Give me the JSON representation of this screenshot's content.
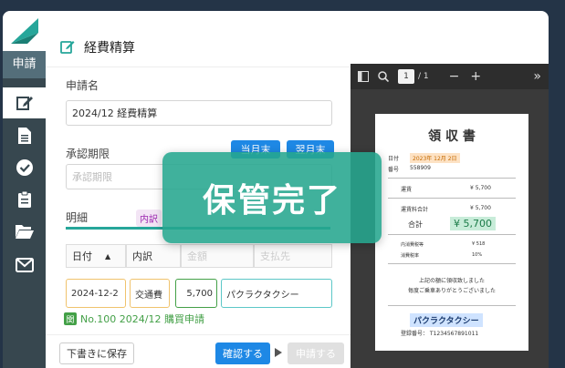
{
  "sidebar": {
    "active_label": "申請",
    "icons": [
      "edit-icon",
      "document-icon",
      "check-circle-icon",
      "clipboard-icon",
      "folder-open-icon",
      "mail-icon"
    ]
  },
  "header": {
    "title": "経費精算"
  },
  "form": {
    "application_name_label": "申請名",
    "application_name_value": "2024/12 経費精算",
    "deadline_label": "承認期限",
    "deadline_placeholder": "承認期限",
    "this_month_end_button": "当月末",
    "next_month_end_button": "翌月末",
    "details_label": "明細",
    "details_chip": "内訳",
    "table_headers": {
      "date": "日付",
      "breakdown": "内訳",
      "amount": "金額",
      "description": "支払先"
    },
    "row": {
      "date": "2024-12-2",
      "category": "交通費",
      "amount": "5,700",
      "description": "パクラクタクシー"
    },
    "link_badge": "関",
    "link_text": "No.100 2024/12 購買申請"
  },
  "footer": {
    "draft_button": "下書きに保存",
    "confirm_button": "確認する",
    "apply_button": "申請する"
  },
  "viewer": {
    "page_current": "1",
    "page_total": "/ 1",
    "zoom_out": "−",
    "zoom_in": "+",
    "more": "»"
  },
  "receipt": {
    "title": "領 収 書",
    "date_label": "日付",
    "date_value": "2023年 12月 2日",
    "number_label": "番号",
    "number_value": "558909",
    "fare_label": "運賃",
    "fare_value": "¥ 5,700",
    "fare_total_label": "運賃料合計",
    "fare_total_value": "¥ 5,700",
    "total_label": "合計",
    "total_value": "¥ 5,700",
    "tax_label": "内消費税等",
    "tax_value": "¥ 518",
    "tax_rate_label": "消費税率",
    "tax_rate_value": "10%",
    "note_line1": "上記の額に領収致しました",
    "note_line2": "毎度ご乗車ありがとうございました",
    "company": "パクラクタクシー",
    "registration": "登録番号： T1234567891011"
  },
  "overlay": {
    "text": "保管完了"
  },
  "colors": {
    "accent_teal": "#26a69a",
    "primary_blue": "#1e88e5",
    "sidebar_dark": "#37474f",
    "overlay_green": "#26a68e"
  }
}
